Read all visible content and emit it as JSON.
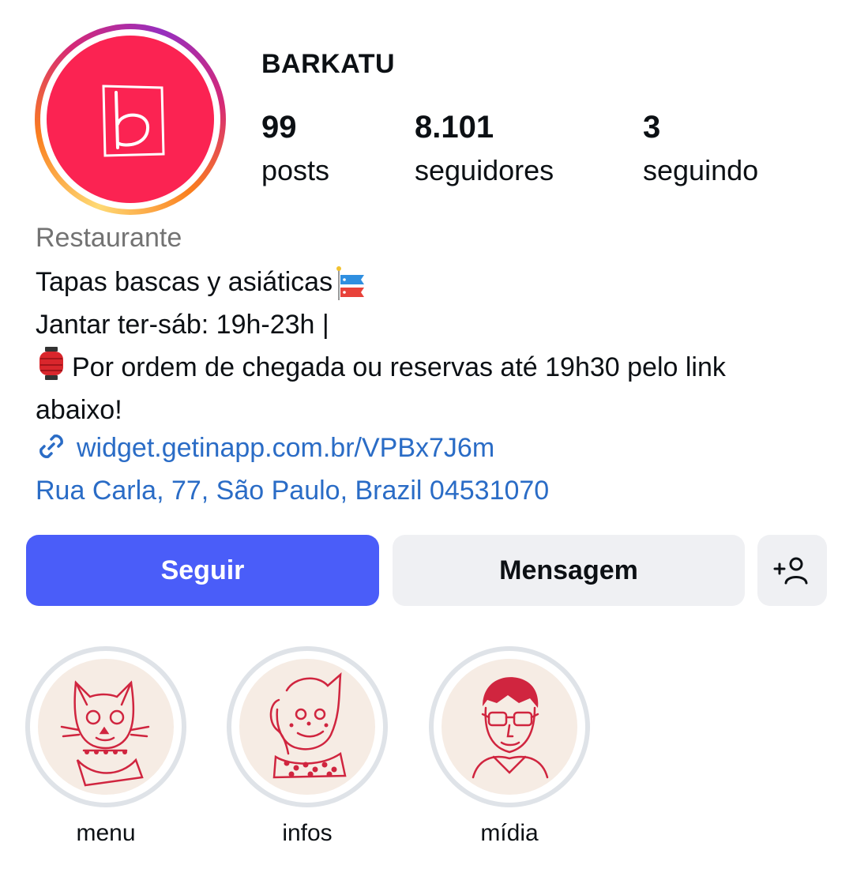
{
  "profile": {
    "username": "BARKATU",
    "stats": {
      "posts": {
        "value": "99",
        "label": "posts"
      },
      "followers": {
        "value": "8.101",
        "label": "seguidores"
      },
      "following": {
        "value": "3",
        "label": "seguindo"
      }
    },
    "category": "Restaurante",
    "bio_lines": [
      "Tapas bascas y asiáticas",
      "Jantar ter-sáb: 19h-23h |",
      "Por ordem de chegada ou reservas até 19h30 pelo link",
      "abaixo!"
    ],
    "link": "widget.getinapp.com.br/VPBx7J6m",
    "address": "Rua Carla, 77, São Paulo, Brazil 04531070"
  },
  "actions": {
    "follow_label": "Seguir",
    "message_label": "Mensagem",
    "suggest_icon": "add-person-icon"
  },
  "highlights": [
    {
      "label": "menu",
      "icon": "cat-illustration"
    },
    {
      "label": "infos",
      "icon": "character-illustration"
    },
    {
      "label": "mídia",
      "icon": "man-with-glasses-illustration"
    }
  ],
  "colors": {
    "avatar_bg": "#fb2352",
    "follow_button": "#4a5df9",
    "link": "#2a6cc6",
    "secondary_button": "#eff0f3",
    "muted_text": "#737373",
    "illustration_red": "#d0253f"
  }
}
